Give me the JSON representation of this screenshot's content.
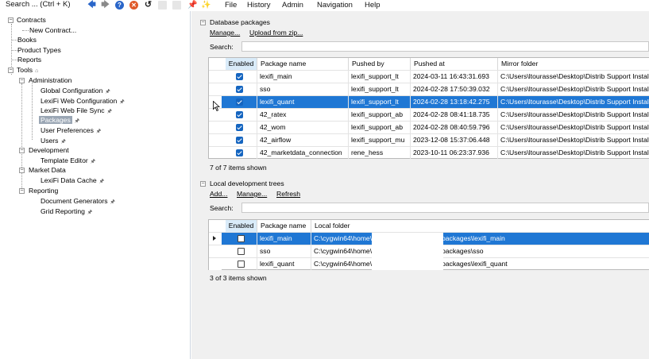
{
  "topbar": {
    "search_label": "Search ... (Ctrl + K)",
    "menu": [
      "File",
      "History",
      "Admin",
      "Navigation",
      "Help"
    ],
    "toolbar_icons": [
      "back-arrow-icon",
      "forward-arrow-icon",
      "help-icon",
      "close-icon",
      "refresh-icon",
      "blank-icon",
      "blank-icon",
      "pin-icon",
      "wand-icon"
    ]
  },
  "tree": {
    "contracts": "Contracts",
    "new_contract": "New Contract...",
    "books": "Books",
    "product_types": "Product Types",
    "reports": "Reports",
    "tools": "Tools",
    "administration": "Administration",
    "global_configuration": "Global Configuration",
    "lexifi_web_configuration": "LexiFi Web Configuration",
    "lexifi_web_file_sync": "LexiFi Web File Sync",
    "packages": "Packages",
    "user_preferences": "User Preferences",
    "users": "Users",
    "development": "Development",
    "template_editor": "Template Editor",
    "market_data": "Market Data",
    "lexifi_data_cache": "LexiFi Data Cache",
    "reporting": "Reporting",
    "document_generators": "Document Generators",
    "grid_reporting": "Grid Reporting"
  },
  "db_packages": {
    "section_title": "Database packages",
    "manage_link": "Manage...",
    "upload_link": "Upload from zip...",
    "search_label": "Search:",
    "search_value": "",
    "columns": [
      "Enabled",
      "Package name",
      "Pushed by",
      "Pushed at",
      "Mirror folder"
    ],
    "rows": [
      {
        "enabled": true,
        "name": "lexifi_main",
        "pushed_by": "lexifi_support_lt",
        "pushed_at": "2024-03-11 16:43:31.693",
        "mirror": "C:\\Users\\ltourasse\\Desktop\\Distrib Support Installs"
      },
      {
        "enabled": true,
        "name": "sso",
        "pushed_by": "lexifi_support_lt",
        "pushed_at": "2024-02-28 17:50:39.032",
        "mirror": "C:\\Users\\ltourasse\\Desktop\\Distrib Support Installs"
      },
      {
        "enabled": true,
        "name": "lexifi_quant",
        "pushed_by": "lexifi_support_lt",
        "pushed_at": "2024-02-28 13:18:42.275",
        "mirror": "C:\\Users\\ltourasse\\Desktop\\Distrib Support Installs"
      },
      {
        "enabled": true,
        "name": "42_ratex",
        "pushed_by": "lexifi_support_ab",
        "pushed_at": "2024-02-28 08:41:18.735",
        "mirror": "C:\\Users\\ltourasse\\Desktop\\Distrib Support Installs"
      },
      {
        "enabled": true,
        "name": "42_wom",
        "pushed_by": "lexifi_support_ab",
        "pushed_at": "2024-02-28 08:40:59.796",
        "mirror": "C:\\Users\\ltourasse\\Desktop\\Distrib Support Installs"
      },
      {
        "enabled": true,
        "name": "42_airflow",
        "pushed_by": "lexifi_support_mu",
        "pushed_at": "2023-12-08 15:37:06.448",
        "mirror": "C:\\Users\\ltourasse\\Desktop\\Distrib Support Installs"
      },
      {
        "enabled": true,
        "name": "42_marketdata_connection",
        "pushed_by": "rene_hess",
        "pushed_at": "2023-10-11 06:23:37.936",
        "mirror": "C:\\Users\\ltourasse\\Desktop\\Distrib Support Installs"
      }
    ],
    "selected_row": 2,
    "status": "7 of 7 items shown"
  },
  "local_trees": {
    "section_title": "Local development trees",
    "add_link": "Add...",
    "manage_link": "Manage...",
    "refresh_link": "Refresh",
    "search_label": "Search:",
    "search_value": "",
    "columns": [
      "Enabled",
      "Package name",
      "Local folder"
    ],
    "rows": [
      {
        "enabled": false,
        "name": "lexifi_main",
        "folder_start": "C:\\cygwin64\\home\\",
        "folder_end": "packages\\lexifi_main"
      },
      {
        "enabled": false,
        "name": "sso",
        "folder_start": "C:\\cygwin64\\home\\",
        "folder_end": "packages\\sso"
      },
      {
        "enabled": false,
        "name": "lexifi_quant",
        "folder_start": "C:\\cygwin64\\home\\",
        "folder_end": "packages\\lexifi_quant"
      }
    ],
    "selected_row": 0,
    "status": "3 of 3 items shown"
  },
  "colors": {
    "selection": "#1f77d4",
    "checkbox": "#1565c0",
    "pane_bg": "#f0f0f0"
  }
}
